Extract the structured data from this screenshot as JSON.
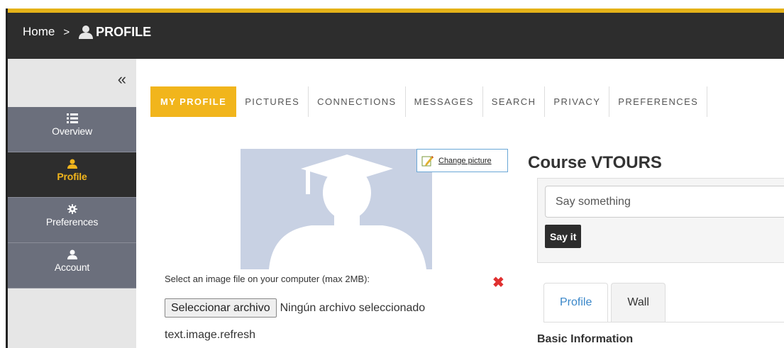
{
  "breadcrumb": {
    "home": "Home",
    "separator": ">",
    "current": "PROFILE"
  },
  "sidebar": {
    "collapse": "«",
    "items": [
      {
        "label": "Overview",
        "icon": "list-icon",
        "active": false
      },
      {
        "label": "Profile",
        "icon": "user-icon",
        "active": true
      },
      {
        "label": "Preferences",
        "icon": "gear-icon",
        "active": false
      },
      {
        "label": "Account",
        "icon": "user-icon",
        "active": false
      }
    ]
  },
  "tabs": [
    {
      "label": "MY PROFILE",
      "active": true
    },
    {
      "label": "PICTURES",
      "active": false
    },
    {
      "label": "CONNECTIONS",
      "active": false
    },
    {
      "label": "MESSAGES",
      "active": false
    },
    {
      "label": "SEARCH",
      "active": false
    },
    {
      "label": "PRIVACY",
      "active": false
    },
    {
      "label": "PREFERENCES",
      "active": false
    }
  ],
  "picture": {
    "change_label": "Change picture",
    "hint": "Select an image file on your computer (max 2MB):",
    "remove": "✖",
    "file_button": "Seleccionar archivo",
    "file_status": "Ningún archivo seleccionado",
    "refresh": "text.image.refresh"
  },
  "course": {
    "title": "Course VTOURS",
    "say_placeholder": "Say something",
    "say_button": "Say it"
  },
  "sub_tabs": [
    {
      "label": "Profile",
      "active": true
    },
    {
      "label": "Wall",
      "active": false
    }
  ],
  "basic_info": "Basic Information",
  "colors": {
    "accent": "#f1b51c",
    "topbar": "#2d2d2d",
    "sidebar_item": "#6b6f7c",
    "link": "#3a87c9"
  }
}
